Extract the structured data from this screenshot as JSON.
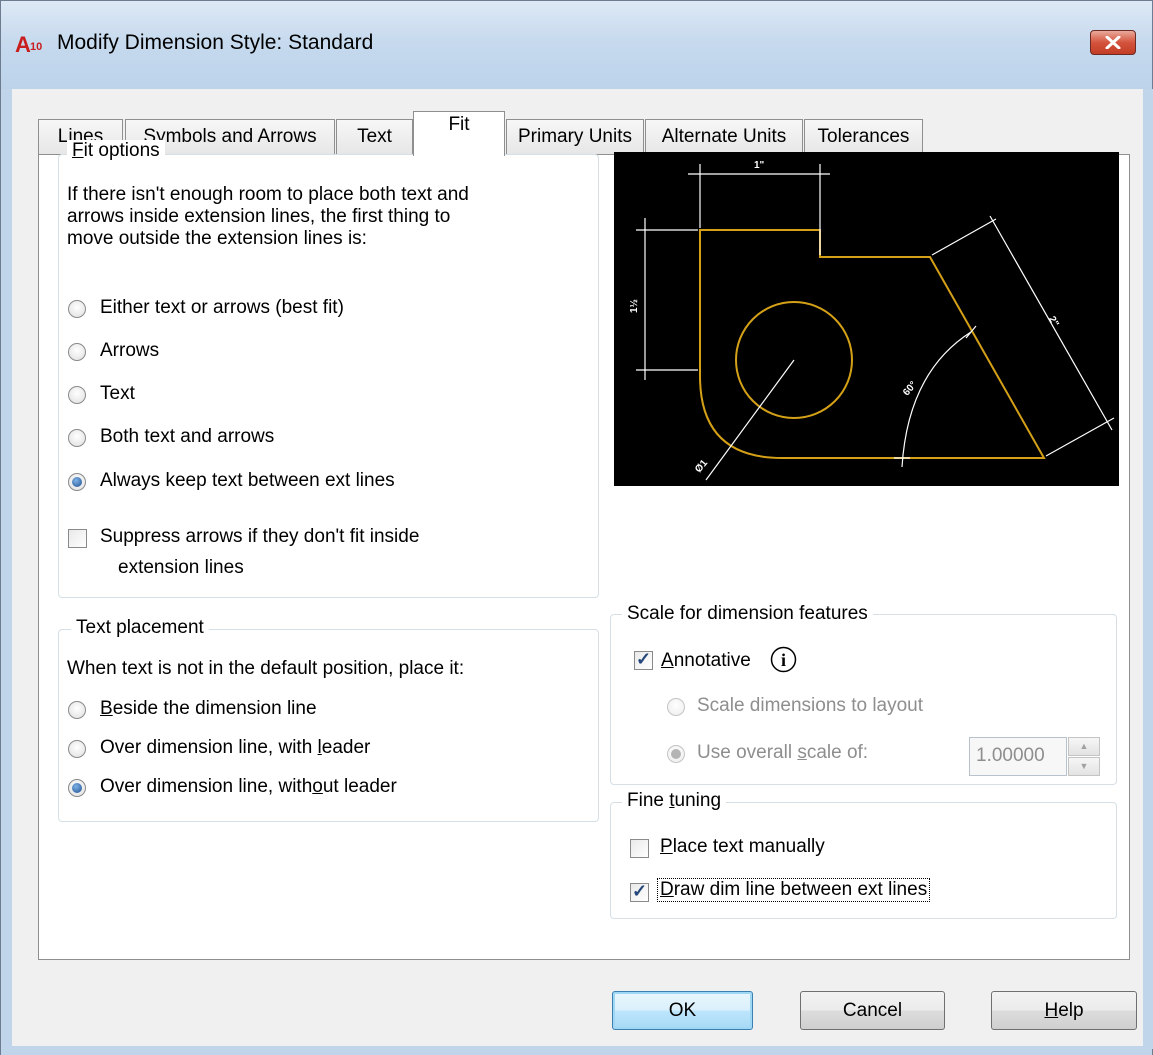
{
  "window": {
    "title": "Modify Dimension Style: Standard",
    "app_icon_text": "A10",
    "close_icon": "close-icon"
  },
  "tabs": [
    {
      "label": "Lines"
    },
    {
      "label": "Symbols and Arrows"
    },
    {
      "label": "Text"
    },
    {
      "label": "Fit",
      "active": true
    },
    {
      "label": "Primary Units"
    },
    {
      "label": "Alternate Units"
    },
    {
      "label": "Tolerances"
    }
  ],
  "fit_options": {
    "legend_first": "F",
    "legend_rest": "it options",
    "description_lines": [
      "If there isn't enough room to place both text and",
      "arrows inside extension lines, the first thing to",
      "move outside the extension lines is:"
    ],
    "radios": [
      {
        "label": "Either text or arrows (best fit)",
        "checked": false
      },
      {
        "label": "Arrows",
        "checked": false
      },
      {
        "label": "Text",
        "checked": false
      },
      {
        "label": "Both text and arrows",
        "checked": false
      },
      {
        "label": "Always keep text between ext lines",
        "checked": true
      }
    ],
    "suppress_label_line1": "Suppress arrows if they don't fit inside",
    "suppress_label_line2": "extension lines",
    "suppress_checked": false
  },
  "text_placement": {
    "legend": "Text placement",
    "description": "When text is not in the default position, place it:",
    "radios": [
      {
        "pre": "",
        "u": "B",
        "post": "eside the dimension line",
        "checked": false
      },
      {
        "pre": "Over dimension line, with ",
        "u": "l",
        "post": "eader",
        "checked": false
      },
      {
        "pre": "Over dimension line, with",
        "u": "o",
        "post": "ut leader",
        "checked": true
      }
    ]
  },
  "scale": {
    "legend": "Scale for dimension features",
    "annotative_u": "A",
    "annotative_rest": "nnotative",
    "annotative_checked": true,
    "info_icon": "info-icon",
    "scale_to_layout": "Scale dimensions to layout",
    "overall_pre": "Use overall ",
    "overall_u": "s",
    "overall_post": "cale of:",
    "overall_value": "1.00000"
  },
  "fine_tuning": {
    "legend_pre": "Fine ",
    "legend_u": "t",
    "legend_post": "uning",
    "place_text_u": "P",
    "place_text_rest": "lace text manually",
    "place_text_checked": false,
    "draw_dim_u": "D",
    "draw_dim_rest": "raw dim line between ext lines",
    "draw_dim_checked": true
  },
  "buttons": {
    "ok": "OK",
    "cancel": "Cancel",
    "help_u": "H",
    "help_rest": "elp"
  },
  "colors": {
    "preview_background": "#000000",
    "geometry": "#d4a017",
    "dimensions": "#ffffff",
    "accent": "#3c7fb1"
  }
}
